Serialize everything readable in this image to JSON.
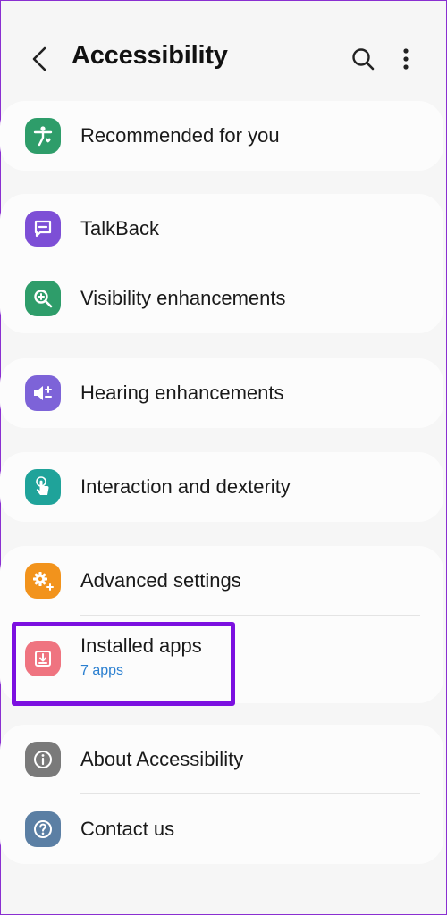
{
  "header": {
    "title": "Accessibility"
  },
  "groups": [
    {
      "items": [
        {
          "label": "Recommended for you",
          "icon": "accessibility-person-icon",
          "color": "#2e9d6a"
        }
      ]
    },
    {
      "items": [
        {
          "label": "TalkBack",
          "icon": "chat-bubble-icon",
          "color": "#7d4fd6"
        },
        {
          "label": "Visibility enhancements",
          "icon": "magnifier-plus-icon",
          "color": "#2e9d6a"
        }
      ]
    },
    {
      "items": [
        {
          "label": "Hearing enhancements",
          "icon": "speaker-plus-minus-icon",
          "color": "#7d63d8"
        }
      ]
    },
    {
      "items": [
        {
          "label": "Interaction and dexterity",
          "icon": "touch-hand-icon",
          "color": "#1fa39a"
        }
      ]
    },
    {
      "items": [
        {
          "label": "Advanced settings",
          "icon": "gear-plus-icon",
          "color": "#f2931c"
        },
        {
          "label": "Installed apps",
          "sublabel": "7 apps",
          "icon": "download-tray-icon",
          "color": "#ef7480"
        }
      ]
    },
    {
      "items": [
        {
          "label": "About Accessibility",
          "icon": "info-icon",
          "color": "#7a7a7a"
        },
        {
          "label": "Contact us",
          "icon": "question-icon",
          "color": "#5b7fa4"
        }
      ]
    }
  ],
  "colors": {
    "highlight": "#7c10e0",
    "sublabel": "#2a7fd0",
    "background": "#f6f6f6",
    "card": "#fcfcfc"
  }
}
